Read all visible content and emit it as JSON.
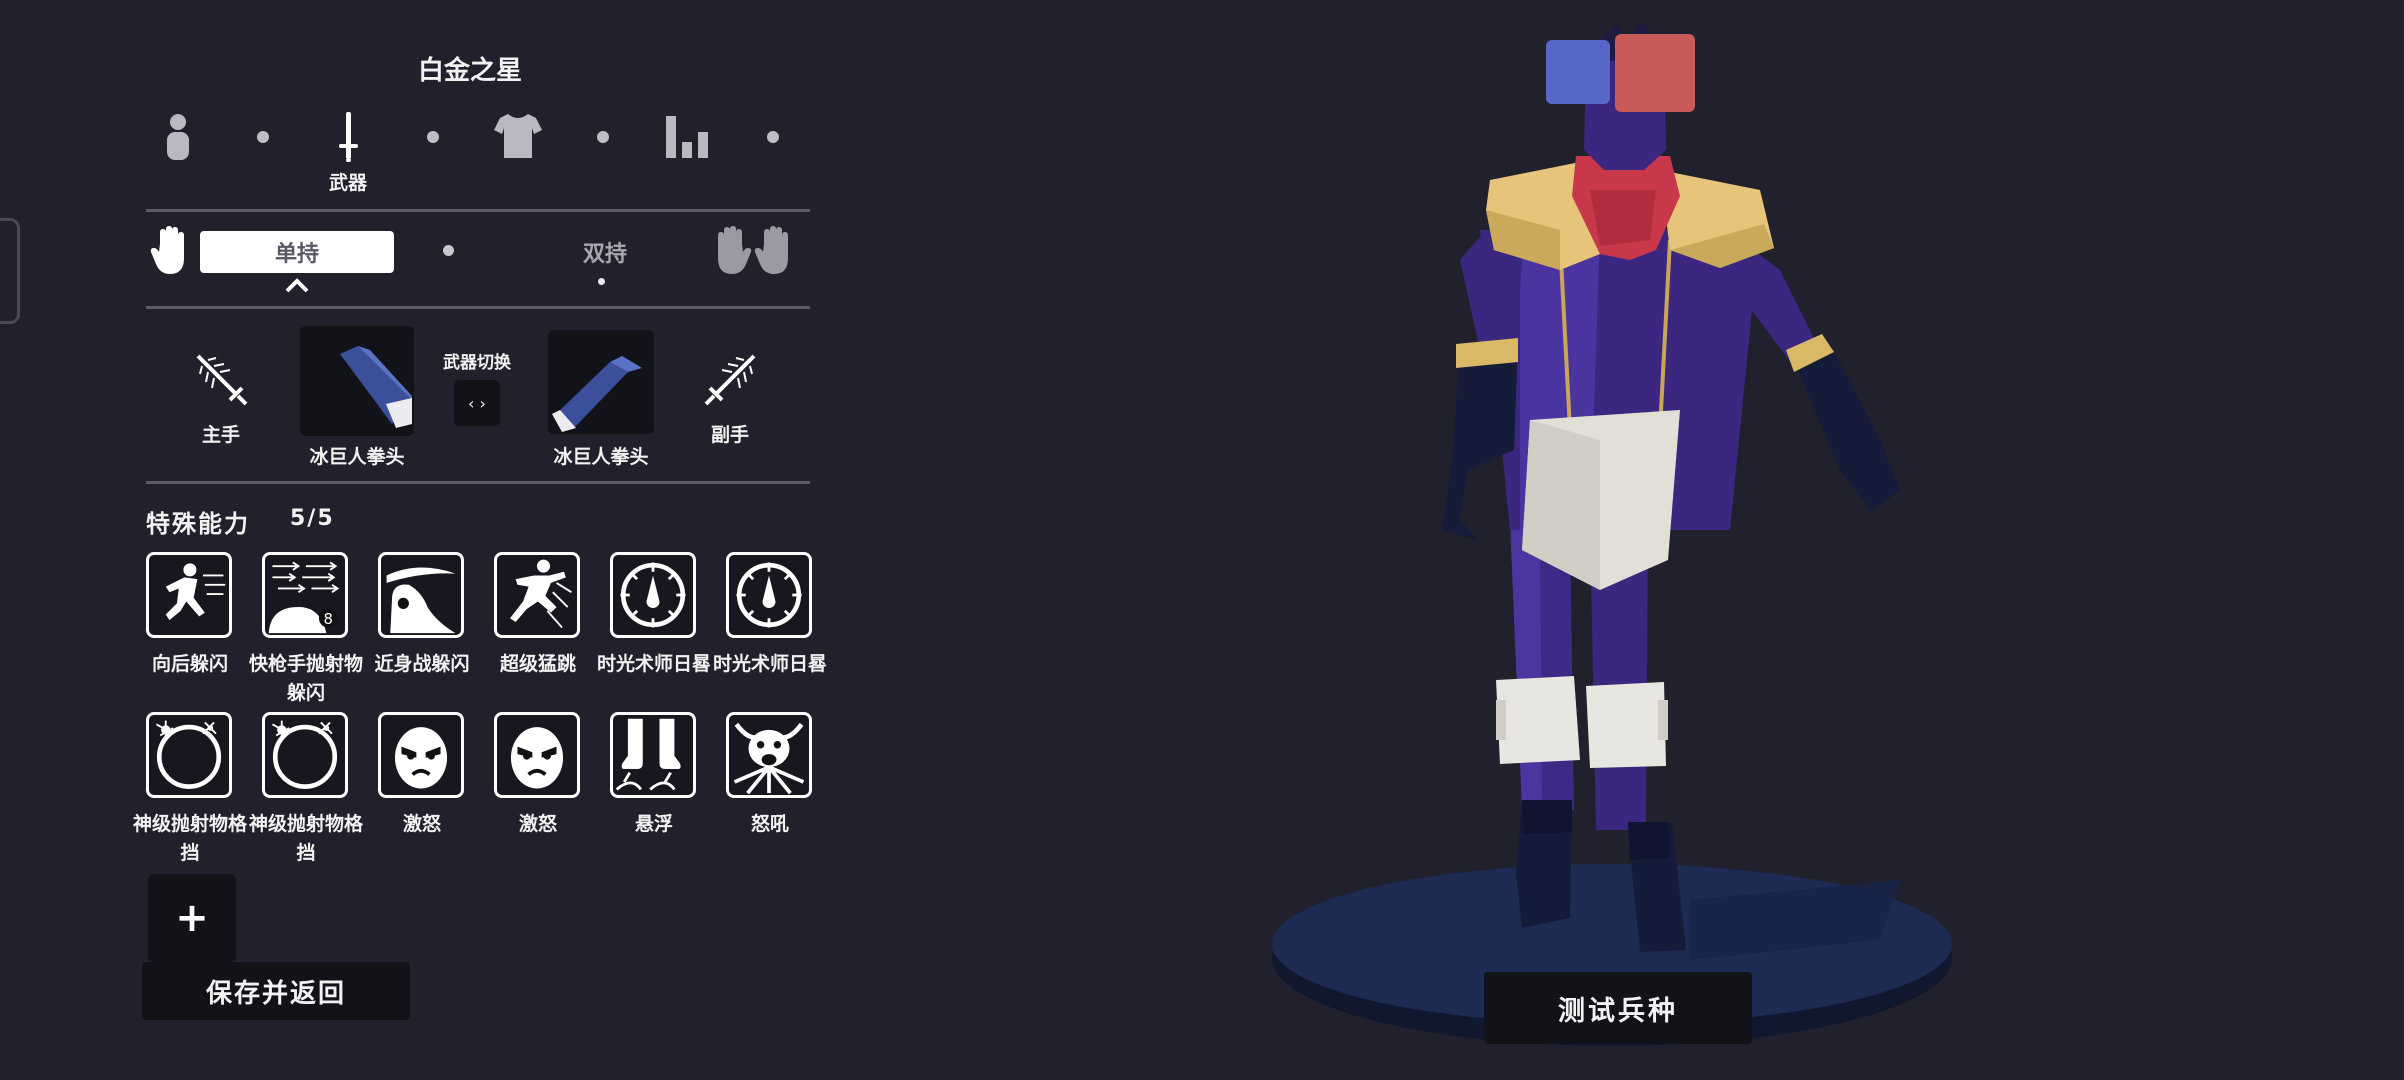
{
  "unit_name": "白金之星",
  "categories": [
    {
      "icon": "body-icon",
      "label": ""
    },
    {
      "icon": "sword-icon",
      "label": "武器",
      "selected": true
    },
    {
      "icon": "shirt-icon",
      "label": ""
    },
    {
      "icon": "stats-icon",
      "label": ""
    }
  ],
  "grip": {
    "single_label": "单持",
    "dual_label": "双持",
    "selected": "single"
  },
  "weapons": {
    "main_hand_label": "主手",
    "off_hand_label": "副手",
    "swap_label": "武器切换",
    "swap_button": "‹ ›",
    "main_weapon_name": "冰巨人拳头",
    "off_weapon_name": "冰巨人拳头"
  },
  "abilities": {
    "title": "特殊能力",
    "count": "5/5",
    "items": [
      {
        "icon": "dodge-back-icon",
        "label": "向后躲闪"
      },
      {
        "icon": "quickdraw-projectile-dodge-icon",
        "label": "快枪手抛射物躲闪"
      },
      {
        "icon": "melee-dodge-icon",
        "label": "近身战躲闪"
      },
      {
        "icon": "super-leap-icon",
        "label": "超级猛跳"
      },
      {
        "icon": "sundial-icon",
        "label": "时光术师日晷"
      },
      {
        "icon": "sundial-icon",
        "label": "时光术师日晷"
      },
      {
        "icon": "projectile-block-icon",
        "label": "神级抛射物格挡"
      },
      {
        "icon": "projectile-block-icon",
        "label": "神级抛射物格挡"
      },
      {
        "icon": "enrage-face-icon",
        "label": "激怒"
      },
      {
        "icon": "enrage-face-icon",
        "label": "激怒"
      },
      {
        "icon": "levitate-icon",
        "label": "悬浮"
      },
      {
        "icon": "roar-icon",
        "label": "怒吼"
      }
    ]
  },
  "add_button": "+",
  "save_button": "保存并返回",
  "test_button": "测试兵种",
  "colors": {
    "background": "#21212d",
    "team_blue": "#5568c8",
    "team_red": "#c85a58",
    "slot_bg": "#121219"
  }
}
